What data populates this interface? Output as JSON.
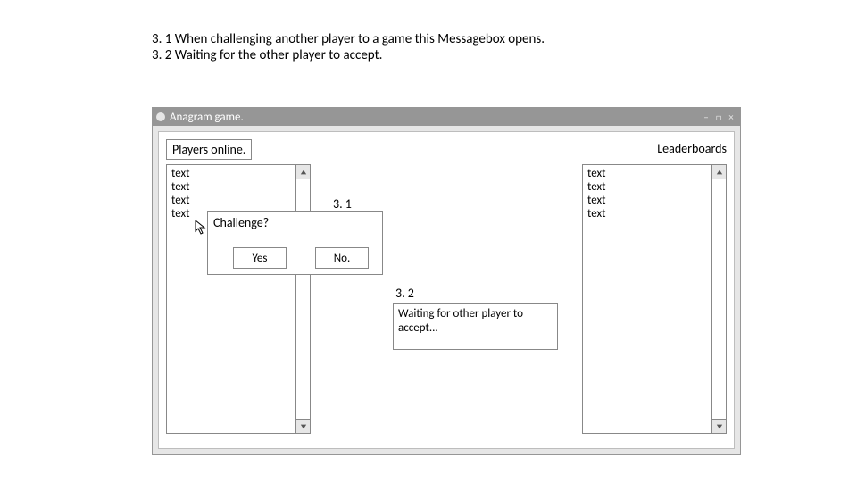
{
  "captions": {
    "line1": "3. 1 When challenging another player to a game this Messagebox opens.",
    "line2": "3. 2 Waiting for the other player to accept."
  },
  "window": {
    "title": "Anagram game.",
    "players_heading": "Players online.",
    "leaderboards_heading": "Leaderboards",
    "players": {
      "i0": "text",
      "i1": "text",
      "i2": "text",
      "i3": "text"
    },
    "leaders": {
      "i0": "text",
      "i1": "text",
      "i2": "text",
      "i3": "text"
    }
  },
  "labels": {
    "l31": "3. 1",
    "l32": "3. 2"
  },
  "challenge": {
    "title": "Challenge?",
    "yes": "Yes",
    "no": "No."
  },
  "waiting": {
    "text": "Waiting for other player to accept..."
  }
}
